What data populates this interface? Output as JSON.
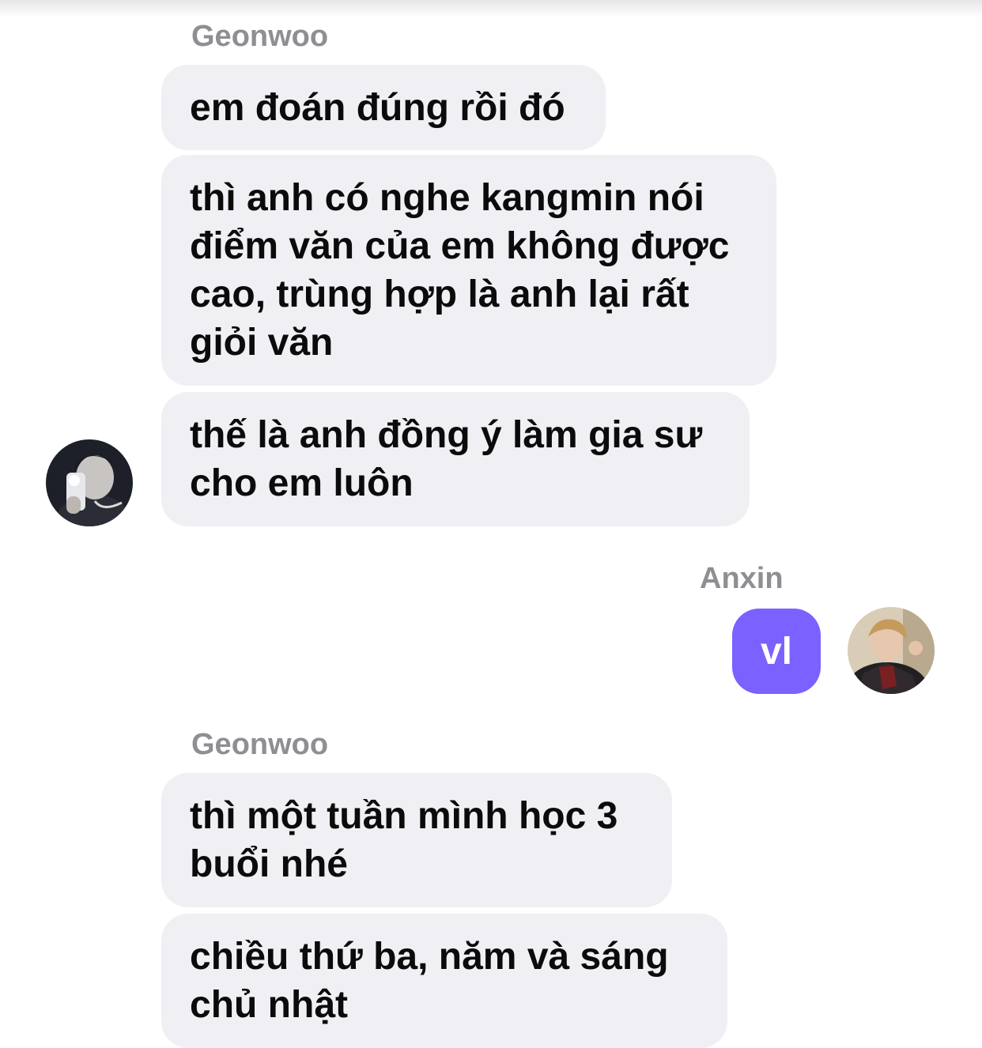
{
  "messages": [
    {
      "sender": "Geonwoo"
    },
    {
      "text": "em đoán đúng rồi đó"
    },
    {
      "text": "thì anh có nghe kangmin nói\nđiểm văn của em không được\ncao, trùng hợp là anh lại rất\ngiỏi văn"
    },
    {
      "text": "thế là anh đồng ý làm gia sư\ncho em luôn"
    },
    {
      "sender": "Anxin"
    },
    {
      "text": "vl"
    },
    {
      "sender": "Geonwoo"
    },
    {
      "text": "thì một tuần mình học 3\nbuổi nhé"
    },
    {
      "text": "chiều thứ ba, năm và sáng\nchủ nhật"
    }
  ],
  "avatars": {
    "geonwoo": "avatar-geonwoo",
    "anxin": "avatar-anxin"
  },
  "colors": {
    "incoming_bubble": "#efeff4",
    "outgoing_bubble": "#7b61ff",
    "sender_name": "#8e8e93"
  }
}
